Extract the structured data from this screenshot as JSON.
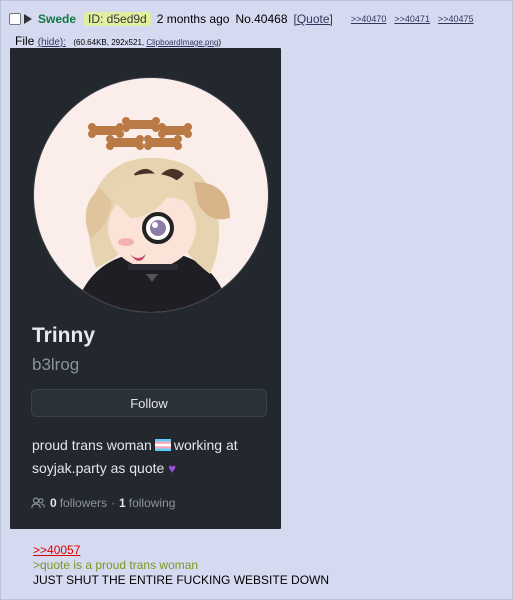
{
  "post": {
    "name": "Swede",
    "id_label": "ID: d5ed9d",
    "time": "2 months ago",
    "number": "No.40468",
    "quote_label": "[Quote]",
    "backlinks": [
      ">>40470",
      ">>40471",
      ">>40475"
    ]
  },
  "file": {
    "label": "File",
    "hide_label": "(hide):",
    "meta": "(60.64KB, 292x521, ",
    "filename": "ClipboardImage.png",
    "meta_close": ")"
  },
  "profile": {
    "display_name": "Trinny",
    "username": "b3lrog",
    "follow_button": "Follow",
    "bio_part1": "proud trans woman",
    "bio_part2": "working at",
    "bio_part3": "soyjak.party as quote",
    "followers_count": "0",
    "followers_label": "followers",
    "separator": "·",
    "following_count": "1",
    "following_label": "following"
  },
  "message": {
    "reply_link": ">>40057",
    "greentext": ">quote is a proud trans woman",
    "text": "JUST SHUT THE ENTIRE FUCKING WEBSITE DOWN"
  },
  "colors": {
    "post_bg": "#D6DAF0",
    "name_green": "#117743",
    "id_bg": "#E0F0A0",
    "link": "#34345C",
    "reply_red": "#DD0000",
    "greentext": "#789922",
    "card_bg": "#23272E"
  },
  "icons": {
    "checkbox": "checkbox-icon",
    "expand": "triangle-right-icon",
    "flag": "trans-flag-icon",
    "heart": "purple-heart-icon",
    "people": "people-icon"
  }
}
